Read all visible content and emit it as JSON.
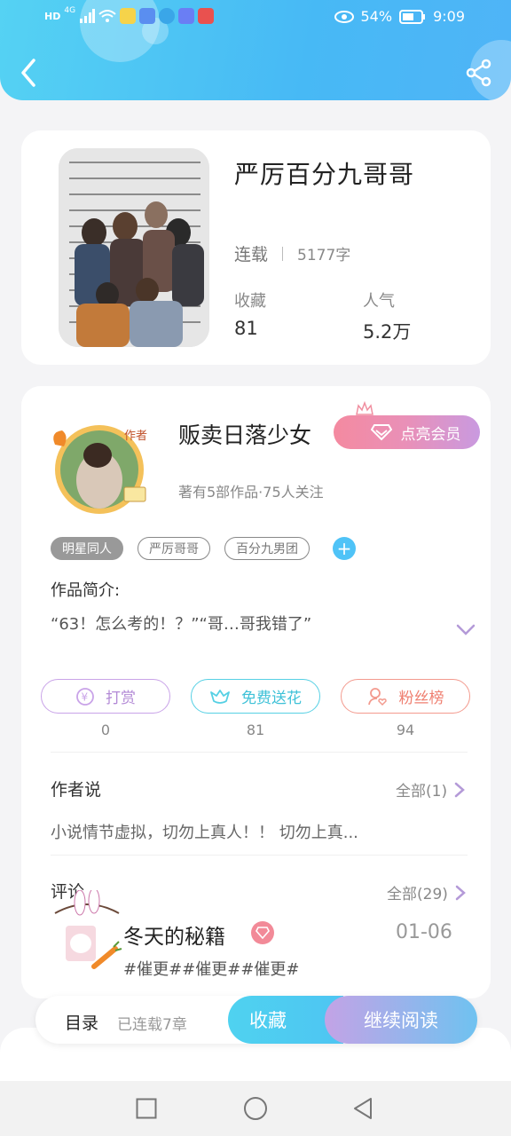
{
  "status_bar": {
    "network": "4G",
    "hd_label": "HD",
    "battery": "54%",
    "time": "9:09"
  },
  "book": {
    "title": "严厉百分九哥哥",
    "status": "连载",
    "word_count": "5177字",
    "favorites_label": "收藏",
    "favorites_value": "81",
    "popularity_label": "人气",
    "popularity_value": "5.2万"
  },
  "author": {
    "badge_text": "作者",
    "name": "贩卖日落少女",
    "vip_label": "点亮会员",
    "info": "著有5部作品·75人关注"
  },
  "tags": [
    "明星同人",
    "严厉哥哥",
    "百分九男团"
  ],
  "intro": {
    "label": "作品简介:",
    "text": "“63！怎么考的！？”“哥…哥我错了”"
  },
  "actions": [
    {
      "label": "打赏",
      "count": "0"
    },
    {
      "label": "免费送花",
      "count": "81"
    },
    {
      "label": "粉丝榜",
      "count": "94"
    }
  ],
  "author_says": {
    "title": "作者说",
    "more": "全部(1)",
    "text": "小说情节虚拟，切勿上真人！！ 切勿上真..."
  },
  "comments": {
    "title": "评论",
    "more": "全部(29)",
    "first": {
      "user": "冬天的秘籍",
      "date": "01-06",
      "text": "#催更##催更##催更#"
    }
  },
  "bottom_bar": {
    "toc": "目录",
    "serial_status": "已连载7章",
    "collect": "收藏",
    "continue": "继续阅读"
  },
  "colors": {
    "header": "#47b9f5",
    "accent_blue": "#4fc3f7",
    "vip_pink": "#f48aa0"
  }
}
